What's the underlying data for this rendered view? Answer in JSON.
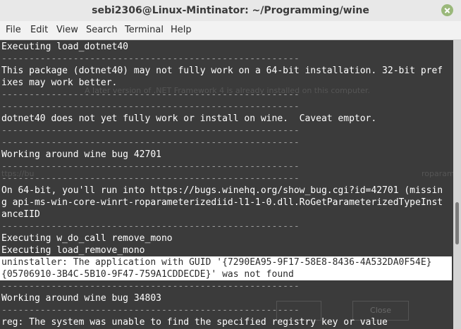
{
  "window": {
    "title": "sebi2306@Linux-Mintinator: ~/Programming/wine"
  },
  "menu": [
    "File",
    "Edit",
    "View",
    "Search",
    "Terminal",
    "Help"
  ],
  "dashes": "------------------------------------------------------",
  "lines": [
    "Executing load_dotnet40",
    "This package (dotnet40) may not fully work on a 64-bit installation. 32-bit pref",
    "ixes may work better.",
    "dotnet40 does not yet fully work or install on wine.  Caveat emptor.",
    "Working around wine bug 42701",
    "On 64-bit, you'll run into https://bugs.winehq.org/show_bug.cgi?id=42701 (missin",
    "g api-ms-win-core-winrt-roparameterizediid-l1-1-0.dll.RoGetParameterizedTypeInst",
    "anceIID",
    "Executing w_do_call remove_mono",
    "Executing load_remove_mono",
    "uninstaller: The application with GUID '{7290EA95-9F17-58E8-8436-4A532DA0F54E}",
    "{05706910-3B4C-5B10-9F47-759A1CDDECDE}' was not found",
    "Working around wine bug 34803",
    "reg: The system was unable to find the specified registry key or value"
  ],
  "behind": {
    "text1": "A later version of .NET Framework 4 is already installed on this computer.",
    "text2": "roparame",
    "text3": "ttps://bu",
    "close_label": "Close"
  }
}
